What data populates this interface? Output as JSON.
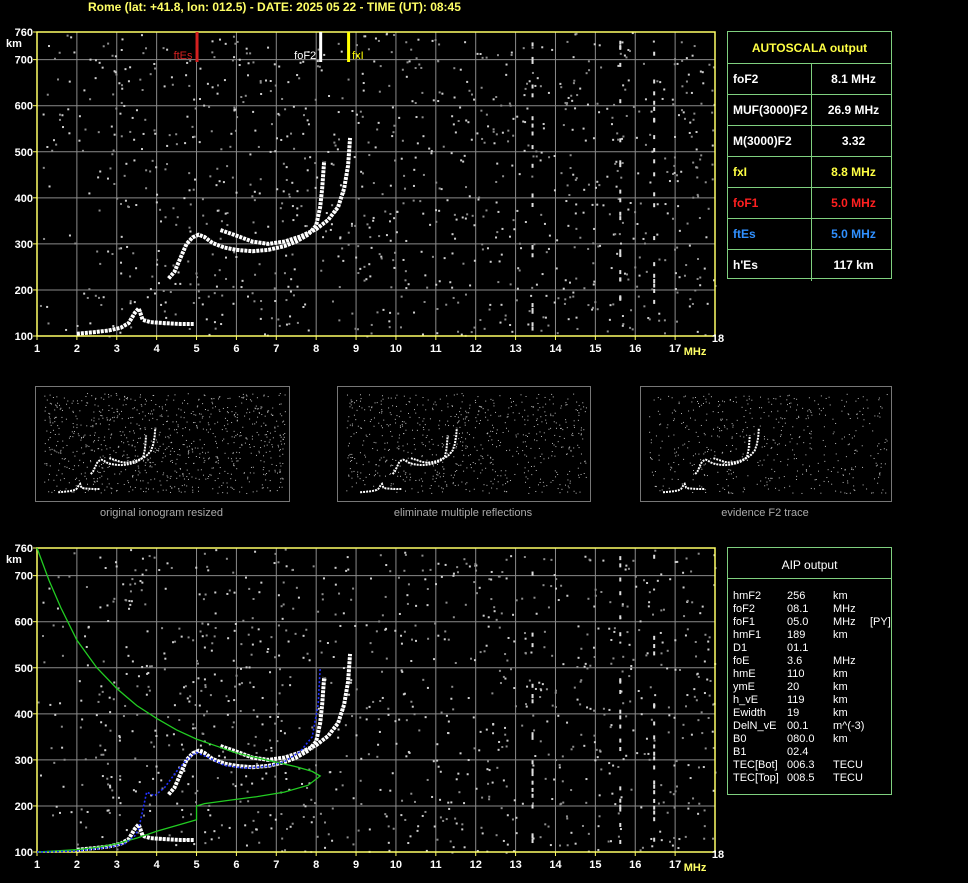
{
  "header": "Rome (lat: +41.8, lon: 012.5) - DATE: 2025 05 22 - TIME (UT): 08:45",
  "colors": {
    "axis": "#ffff66",
    "grid": "#8a8a8a",
    "fxl": "#ffff00",
    "fbEs": "#d42020",
    "foF2": "#ffffff",
    "profile": "#22cc22",
    "fit": "#2030ff",
    "panelBorder": "#7fd07f"
  },
  "chart_data": {
    "type": "scatter",
    "x_unit": "MHz",
    "y_unit": "km",
    "xlim": [
      1,
      18
    ],
    "ylim": [
      100,
      760
    ],
    "x_ticks": [
      "1",
      "2",
      "3",
      "4",
      "5",
      "6",
      "7",
      "8",
      "9",
      "10",
      "11",
      "12",
      "13",
      "14",
      "15",
      "16",
      "17",
      "18"
    ],
    "y_ticks": [
      "100",
      "200",
      "300",
      "400",
      "500",
      "600",
      "700",
      "760"
    ],
    "grid": true,
    "markers": [
      {
        "label": "ftEs",
        "x": 5.0,
        "color": "#d42020"
      },
      {
        "label": "foF2",
        "x": 8.1,
        "color": "#ffffff"
      },
      {
        "label": "fxI",
        "x": 8.8,
        "color": "#ffff00"
      }
    ],
    "traces": [
      {
        "name": "Es",
        "points": [
          [
            2.0,
            105
          ],
          [
            2.4,
            108
          ],
          [
            2.8,
            112
          ],
          [
            3.1,
            118
          ],
          [
            3.3,
            128
          ],
          [
            3.45,
            150
          ],
          [
            3.55,
            160
          ],
          [
            3.65,
            135
          ],
          [
            3.85,
            130
          ],
          [
            4.2,
            128
          ],
          [
            4.6,
            126
          ],
          [
            4.95,
            126
          ]
        ]
      },
      {
        "name": "F-o",
        "points": [
          [
            4.3,
            225
          ],
          [
            4.45,
            240
          ],
          [
            4.6,
            270
          ],
          [
            4.75,
            300
          ],
          [
            4.9,
            314
          ],
          [
            5.05,
            320
          ],
          [
            5.2,
            315
          ],
          [
            5.4,
            302
          ],
          [
            5.7,
            292
          ],
          [
            6.0,
            287
          ],
          [
            6.4,
            284
          ],
          [
            6.8,
            287
          ],
          [
            7.2,
            295
          ],
          [
            7.5,
            305
          ],
          [
            7.8,
            320
          ],
          [
            8.0,
            340
          ],
          [
            8.1,
            380
          ],
          [
            8.15,
            420
          ],
          [
            8.2,
            480
          ]
        ]
      },
      {
        "name": "F-x",
        "points": [
          [
            5.6,
            330
          ],
          [
            6.0,
            318
          ],
          [
            6.4,
            305
          ],
          [
            6.8,
            300
          ],
          [
            7.2,
            305
          ],
          [
            7.6,
            316
          ],
          [
            8.0,
            332
          ],
          [
            8.3,
            352
          ],
          [
            8.55,
            380
          ],
          [
            8.7,
            420
          ],
          [
            8.8,
            470
          ],
          [
            8.85,
            530
          ]
        ]
      }
    ],
    "aip_profile": [
      [
        1.0,
        760
      ],
      [
        1.3,
        690
      ],
      [
        1.6,
        630
      ],
      [
        2.0,
        560
      ],
      [
        2.5,
        500
      ],
      [
        3.0,
        455
      ],
      [
        3.5,
        418
      ],
      [
        4.0,
        390
      ],
      [
        4.5,
        365
      ],
      [
        5.0,
        345
      ],
      [
        5.5,
        330
      ],
      [
        6.0,
        315
      ],
      [
        6.5,
        305
      ],
      [
        7.0,
        295
      ],
      [
        7.5,
        285
      ],
      [
        7.9,
        275
      ],
      [
        8.1,
        265
      ],
      [
        7.8,
        245
      ],
      [
        7.2,
        230
      ],
      [
        6.5,
        220
      ],
      [
        5.8,
        212
      ],
      [
        5.2,
        205
      ],
      [
        5.0,
        200
      ],
      [
        5.0,
        170
      ],
      [
        4.6,
        160
      ],
      [
        4.0,
        145
      ],
      [
        3.5,
        130
      ],
      [
        3.0,
        118
      ],
      [
        2.5,
        110
      ],
      [
        2.0,
        105
      ],
      [
        1.0,
        100
      ]
    ],
    "aip_fit": [
      [
        1.0,
        100
      ],
      [
        2.0,
        102
      ],
      [
        2.8,
        110
      ],
      [
        3.2,
        118
      ],
      [
        3.45,
        135
      ],
      [
        3.55,
        150
      ],
      [
        3.75,
        230
      ],
      [
        3.95,
        222
      ],
      [
        4.2,
        240
      ],
      [
        4.5,
        275
      ],
      [
        4.8,
        305
      ],
      [
        5.0,
        316
      ],
      [
        5.3,
        305
      ],
      [
        5.7,
        288
      ],
      [
        6.2,
        282
      ],
      [
        6.8,
        286
      ],
      [
        7.2,
        296
      ],
      [
        7.6,
        318
      ],
      [
        7.9,
        350
      ],
      [
        8.05,
        420
      ],
      [
        8.1,
        500
      ]
    ]
  },
  "autoscala": {
    "title": "AUTOSCALA output",
    "rows": [
      {
        "label": "foF2",
        "value": "8.1 MHz",
        "color": "#ffffff"
      },
      {
        "label": "MUF(3000)F2",
        "value": "26.9 MHz",
        "color": "#ffffff"
      },
      {
        "label": "M(3000)F2",
        "value": "3.32",
        "color": "#ffffff"
      },
      {
        "label": "fxI",
        "value": "8.8 MHz",
        "color": "#ffff44"
      },
      {
        "label": "foF1",
        "value": "5.0 MHz",
        "color": "#ff2020"
      },
      {
        "label": "ftEs",
        "value": "5.0 MHz",
        "color": "#3090ff"
      },
      {
        "label": "h'Es",
        "value": "117    km",
        "color": "#ffffff"
      }
    ]
  },
  "thumbnails": [
    {
      "caption": "original ionogram resized"
    },
    {
      "caption": "eliminate multiple reflections"
    },
    {
      "caption": "evidence F2 trace"
    }
  ],
  "aip": {
    "title": "AIP output",
    "rows": [
      {
        "k": "hmF2",
        "v": "256",
        "u": "km",
        "x": ""
      },
      {
        "k": "foF2",
        "v": "08.1",
        "u": "MHz",
        "x": ""
      },
      {
        "k": "foF1",
        "v": "05.0",
        "u": "MHz",
        "x": "[PY]"
      },
      {
        "k": "hmF1",
        "v": "189",
        "u": "km",
        "x": ""
      },
      {
        "k": "D1",
        "v": "01.1",
        "u": "",
        "x": ""
      },
      {
        "k": "foE",
        "v": "3.6",
        "u": "MHz",
        "x": ""
      },
      {
        "k": "hmE",
        "v": "110",
        "u": "km",
        "x": ""
      },
      {
        "k": "ymE",
        "v": "20",
        "u": "km",
        "x": ""
      },
      {
        "k": "h_vE",
        "v": "119",
        "u": "km",
        "x": ""
      },
      {
        "k": "Ewidth",
        "v": "19",
        "u": "km",
        "x": ""
      },
      {
        "k": "DelN_vE",
        "v": "00.1",
        "u": "m^(-3)",
        "x": ""
      },
      {
        "k": "B0",
        "v": "080.0",
        "u": "km",
        "x": ""
      },
      {
        "k": "B1",
        "v": "02.4",
        "u": "",
        "x": ""
      },
      {
        "k": "TEC[Bot]",
        "v": "006.3",
        "u": "TECU",
        "x": ""
      },
      {
        "k": "TEC[Top]",
        "v": "008.5",
        "u": "TECU",
        "x": ""
      }
    ]
  }
}
